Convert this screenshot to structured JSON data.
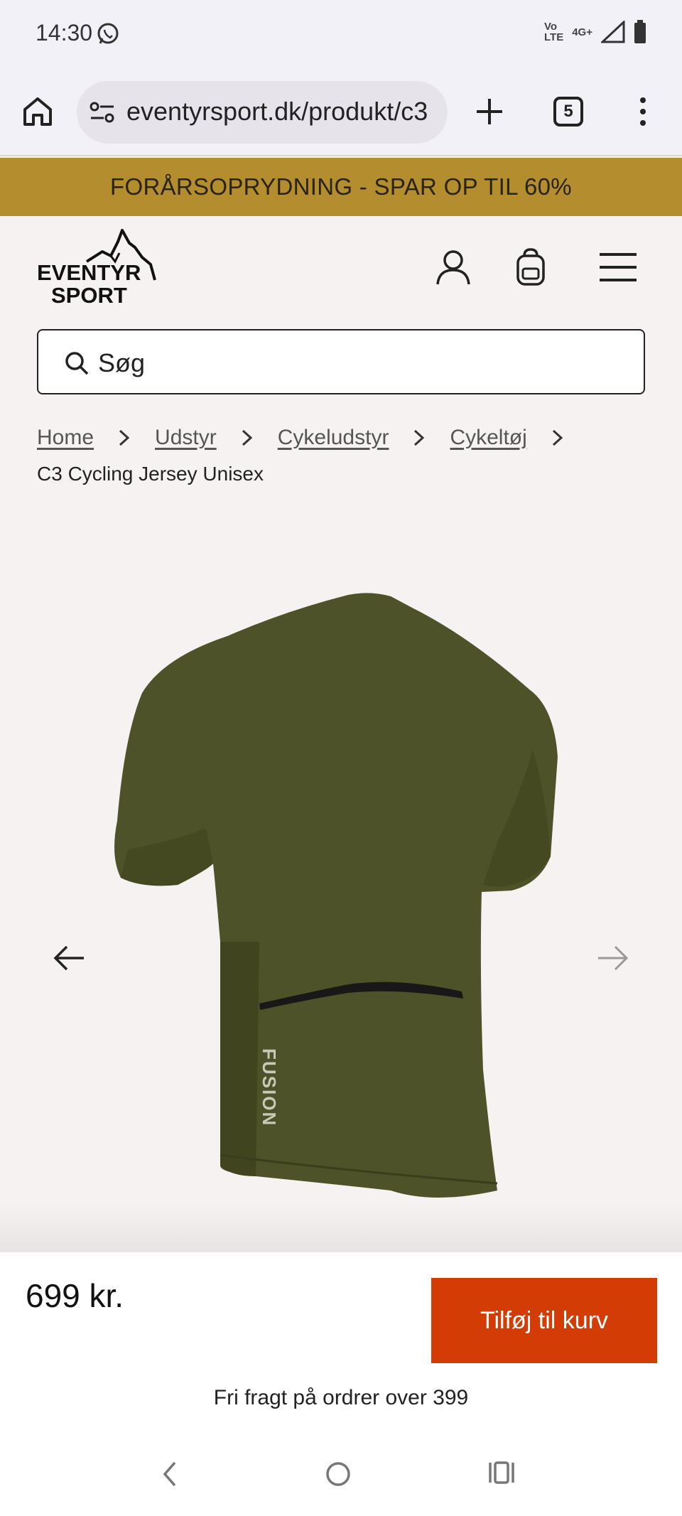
{
  "status_bar": {
    "time": "14:30",
    "network_top": "Vo",
    "network_bottom": "LTE",
    "network_type": "4G+"
  },
  "browser": {
    "url": "eventyrsport.dk/produkt/c3",
    "tab_count": "5"
  },
  "promo": {
    "text": "FORÅRSOPRYDNING - SPAR OP TIL 60%",
    "background": "#b38d2e"
  },
  "logo": {
    "line1": "EVENTYR",
    "line2": "SPORT"
  },
  "search": {
    "placeholder": "Søg"
  },
  "breadcrumb": {
    "items": [
      "Home",
      "Udstyr",
      "Cykeludstyr",
      "Cykeltøj"
    ],
    "current": "C3 Cycling Jersey Unisex"
  },
  "product": {
    "brand_print": "FUSION",
    "jersey_color": "#4d5228",
    "price": "699 kr.",
    "add_to_cart": "Tilføj til kurv",
    "add_to_cart_color": "#d43c06",
    "shipping_note": "Fri fragt på ordrer over 399"
  },
  "icons": [
    "whatsapp-icon",
    "signal-icon",
    "battery-icon",
    "home-icon",
    "site-settings-icon",
    "plus-icon",
    "more-icon",
    "account-icon",
    "bag-icon",
    "menu-icon",
    "search-icon",
    "chevron-right-icon",
    "arrow-left-icon",
    "arrow-right-icon"
  ]
}
